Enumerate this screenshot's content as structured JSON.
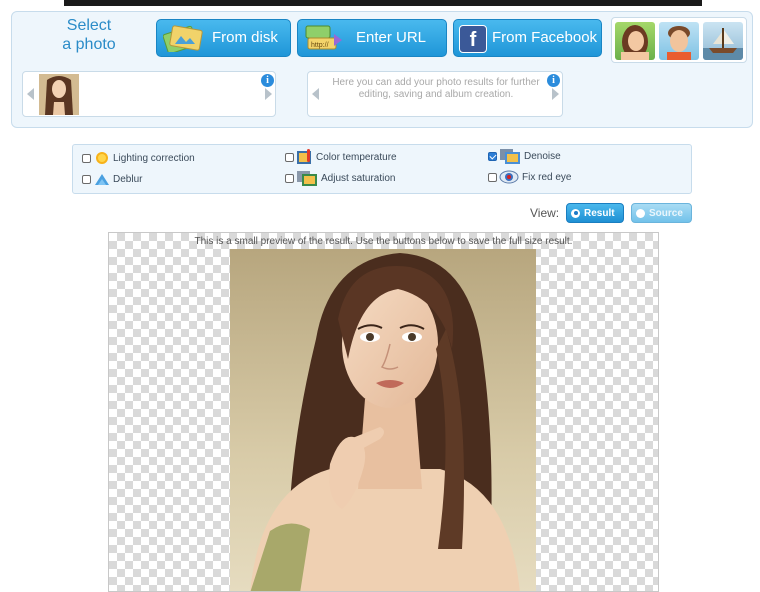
{
  "header": {
    "select_label": "Select a photo",
    "buttons": [
      {
        "label": "From disk",
        "icon": "folder-photos-icon"
      },
      {
        "label": "Enter URL",
        "icon": "url-link-icon"
      },
      {
        "label": "From Facebook",
        "icon": "facebook-icon"
      }
    ],
    "sample_thumbs": [
      "sample-woman-thumb",
      "sample-man-thumb",
      "sample-boat-thumb"
    ]
  },
  "source_strip": {
    "thumb": "woman-portrait-thumb"
  },
  "result_strip": {
    "text": "Here you can add your photo results for further editing, saving and album creation."
  },
  "options": [
    {
      "label": "Lighting correction",
      "checked": false,
      "icon": "sun-icon"
    },
    {
      "label": "Color temperature",
      "checked": false,
      "icon": "thermometer-icon"
    },
    {
      "label": "Denoise",
      "checked": true,
      "icon": "denoise-icon"
    },
    {
      "label": "Deblur",
      "checked": false,
      "icon": "blur-drop-icon"
    },
    {
      "label": "Adjust saturation",
      "checked": false,
      "icon": "saturation-icon"
    },
    {
      "label": "Fix red eye",
      "checked": false,
      "icon": "eye-icon"
    }
  ],
  "view": {
    "label": "View:",
    "result_label": "Result",
    "source_label": "Source",
    "selected": "Result"
  },
  "preview": {
    "note": "This is a small preview of the result. Use the buttons below to save the full size result."
  },
  "colors": {
    "accent": "#2b8cc8",
    "button_blue": "#1f96d8",
    "panel_bg": "#eef6fc"
  }
}
